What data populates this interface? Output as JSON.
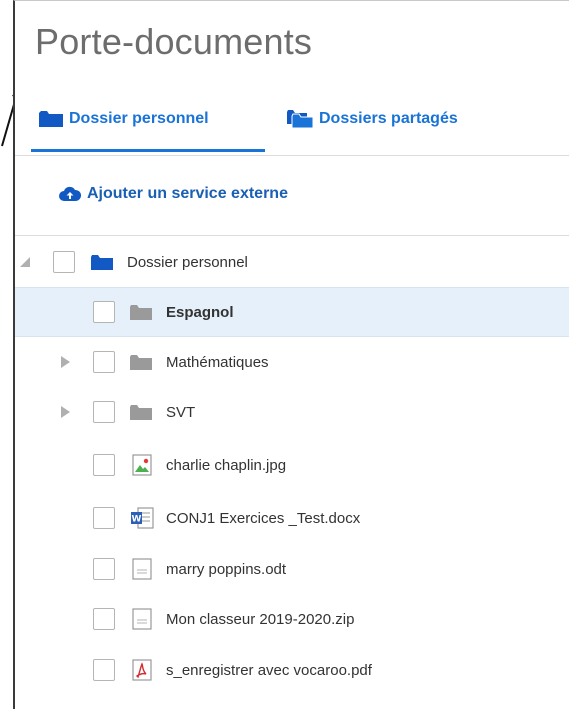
{
  "title": "Porte-documents",
  "tabs": [
    {
      "label": "Dossier personnel",
      "icon": "folder-icon",
      "active": true
    },
    {
      "label": "Dossiers partagés",
      "icon": "shared-folders-icon",
      "active": false
    }
  ],
  "external_service": {
    "label": "Ajouter un service externe",
    "icon": "cloud-upload-icon"
  },
  "colors": {
    "accent": "#1a73d6",
    "folder_dark": "#1259c3",
    "folder_grey": "#9a9a9a",
    "selected_row": "#e6f0fa"
  },
  "tree": {
    "root": {
      "label": "Dossier personnel",
      "icon": "folder-icon",
      "expanded": true
    },
    "items": [
      {
        "label": "Espagnol",
        "icon": "folder-icon",
        "selected": true,
        "bold": true,
        "expandable": false
      },
      {
        "label": "Mathématiques",
        "icon": "folder-icon",
        "selected": false,
        "bold": false,
        "expandable": true
      },
      {
        "label": "SVT",
        "icon": "folder-icon",
        "selected": false,
        "bold": false,
        "expandable": true
      },
      {
        "label": "charlie chaplin.jpg",
        "icon": "image-file-icon",
        "selected": false,
        "bold": false,
        "expandable": false
      },
      {
        "label": "CONJ1 Exercices _Test.docx",
        "icon": "word-file-icon",
        "selected": false,
        "bold": false,
        "expandable": false
      },
      {
        "label": "marry poppins.odt",
        "icon": "document-file-icon",
        "selected": false,
        "bold": false,
        "expandable": false
      },
      {
        "label": "Mon classeur 2019-2020.zip",
        "icon": "document-file-icon",
        "selected": false,
        "bold": false,
        "expandable": false
      },
      {
        "label": "s_enregistrer avec vocaroo.pdf",
        "icon": "pdf-file-icon",
        "selected": false,
        "bold": false,
        "expandable": false
      }
    ]
  }
}
